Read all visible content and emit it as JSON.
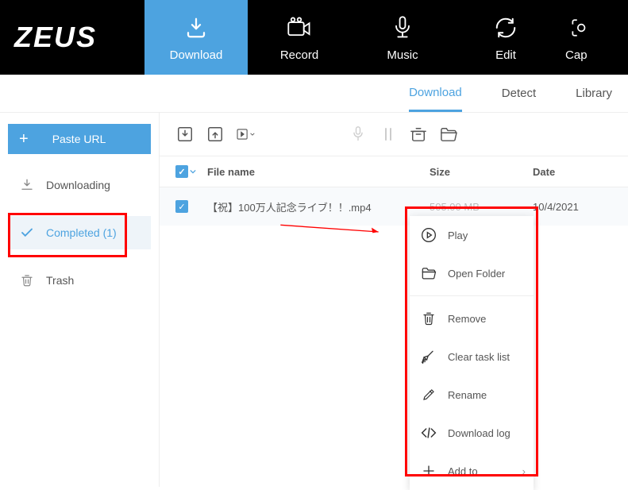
{
  "brand": "ZEUS",
  "nav": {
    "download": "Download",
    "record": "Record",
    "music": "Music",
    "edit": "Edit",
    "capture": "Cap"
  },
  "subnav": {
    "download": "Download",
    "detect": "Detect",
    "library": "Library"
  },
  "sidebar": {
    "paste_url": "Paste URL",
    "downloading": "Downloading",
    "completed": "Completed (1)",
    "trash": "Trash"
  },
  "table": {
    "headers": {
      "name": "File name",
      "size": "Size",
      "date": "Date"
    },
    "rows": [
      {
        "name": "【祝】100万人記念ライブ！！.mp4",
        "size": "505.00 MB",
        "date": "10/4/2021"
      }
    ]
  },
  "context_menu": {
    "play": "Play",
    "open_folder": "Open Folder",
    "remove": "Remove",
    "clear_task": "Clear task list",
    "rename": "Rename",
    "download_log": "Download log",
    "add_to": "Add to"
  }
}
